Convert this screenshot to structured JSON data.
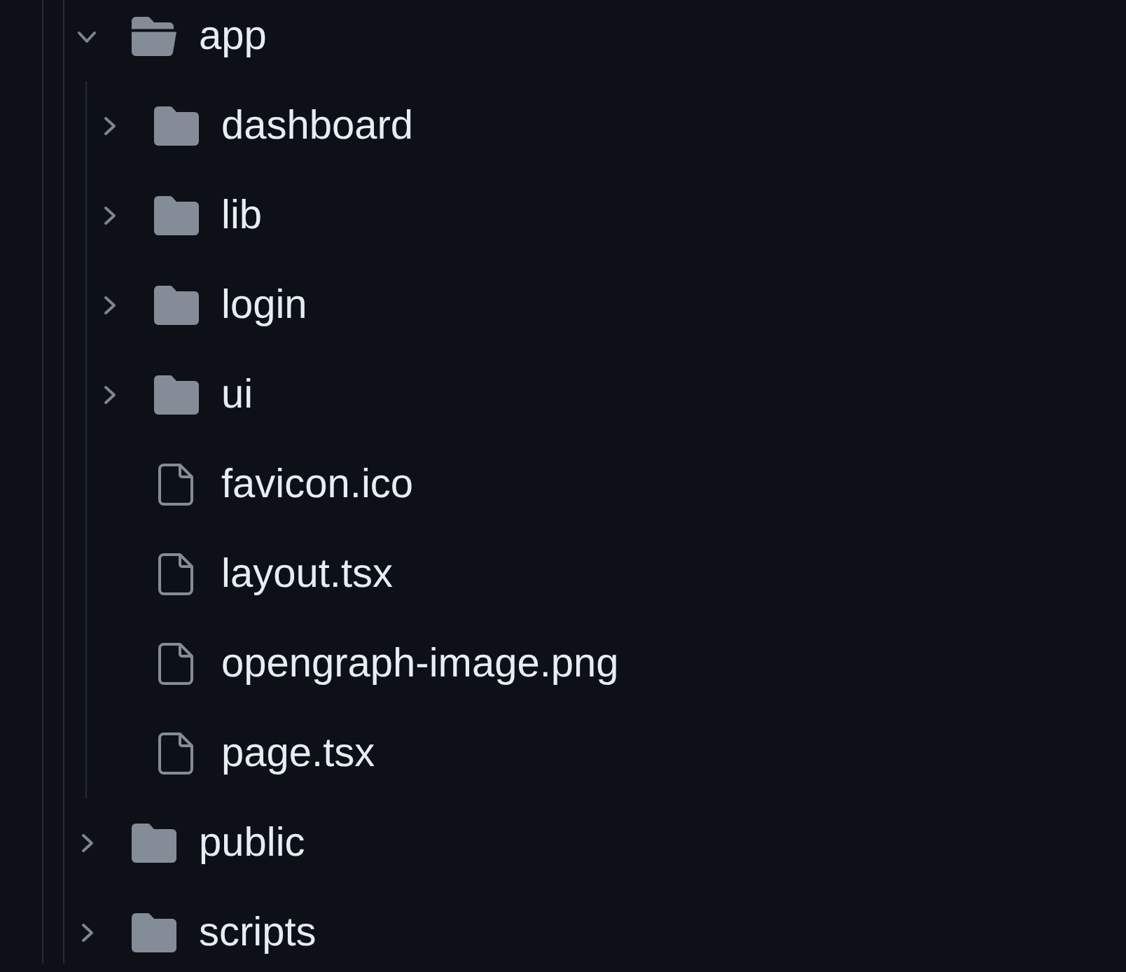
{
  "tree": [
    {
      "kind": "folder",
      "name": "app",
      "expanded": true,
      "children": [
        {
          "kind": "folder",
          "name": "dashboard",
          "expanded": false
        },
        {
          "kind": "folder",
          "name": "lib",
          "expanded": false
        },
        {
          "kind": "folder",
          "name": "login",
          "expanded": false
        },
        {
          "kind": "folder",
          "name": "ui",
          "expanded": false
        },
        {
          "kind": "file",
          "name": "favicon.ico"
        },
        {
          "kind": "file",
          "name": "layout.tsx"
        },
        {
          "kind": "file",
          "name": "opengraph-image.png"
        },
        {
          "kind": "file",
          "name": "page.tsx"
        }
      ]
    },
    {
      "kind": "folder",
      "name": "public",
      "expanded": false
    },
    {
      "kind": "folder",
      "name": "scripts",
      "expanded": false
    }
  ]
}
